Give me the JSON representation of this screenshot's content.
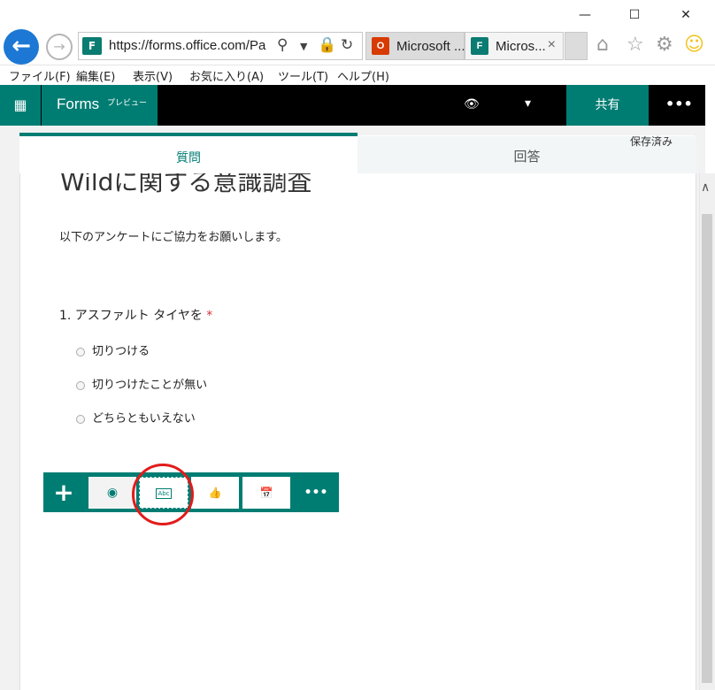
{
  "window": {
    "minimize": "—",
    "maximize": "☐",
    "close": "✕"
  },
  "address": {
    "url": "https://forms.office.com/Pa"
  },
  "tabs": [
    {
      "label": "Microsoft ...",
      "favicon_color": "#d83b01"
    },
    {
      "label": "Micros...",
      "favicon_color": "#0a7c72",
      "close": "×"
    }
  ],
  "menu": [
    "ファイル(F)",
    "編集(E)",
    "表示(V)",
    "お気に入り(A)",
    "ツール(T)",
    "ヘルプ(H)"
  ],
  "appbar": {
    "waffle": "⋮⋮⋮",
    "brand": "Forms",
    "tag": "プレビュー",
    "share": "共有",
    "more": "•••"
  },
  "tabs_main": {
    "question": "質問",
    "responses": "回答",
    "saved": "保存済み"
  },
  "form": {
    "title": "Wildに関する意識調査",
    "description": "以下のアンケートにご協力をお願いします。",
    "question1": {
      "label": "1. アスファルト タイヤを ",
      "required_mark": "*",
      "options": [
        "切りつける",
        "切りつけたことが無い",
        "どちらともいえない"
      ]
    }
  },
  "toolbar": {
    "add": "+",
    "choice_icon": "◉",
    "text_icon": "Abc",
    "rating_icon": "👍",
    "date_icon": "📅",
    "more": "•••"
  },
  "colors": {
    "accent": "#007d73",
    "highlight": "#e21b1b"
  }
}
